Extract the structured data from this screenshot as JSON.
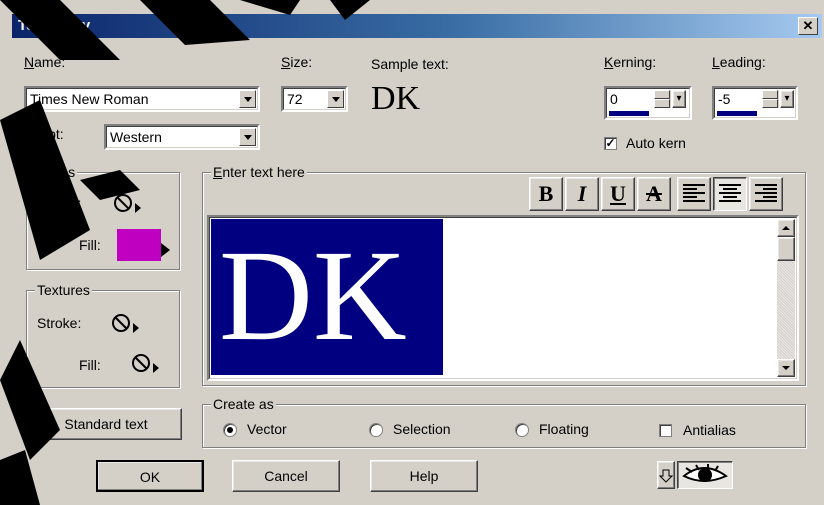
{
  "window": {
    "title": "Text Entry",
    "close_glyph": "✕"
  },
  "name": {
    "label": "Name:",
    "value": "Times New Roman"
  },
  "size": {
    "label": "Size:",
    "value": "72"
  },
  "sample": {
    "label": "Sample text:",
    "value": "DK"
  },
  "kerning": {
    "label": "Kerning:",
    "value": "0"
  },
  "leading": {
    "label": "Leading:",
    "value": "-5"
  },
  "auto_kern": {
    "label": "Auto kern",
    "checked": true,
    "check_glyph": "✓"
  },
  "script": {
    "label": "Script:",
    "value": "Western"
  },
  "styles": {
    "title": "Styles",
    "stroke_label": "Stroke:",
    "fill_label": "Fill:",
    "fill_color": "#c000c0"
  },
  "textures": {
    "title": "Textures",
    "stroke_label": "Stroke:",
    "fill_label": "Fill:"
  },
  "editor": {
    "title": "Enter text here",
    "content": "DK",
    "highlight_color": "#000080"
  },
  "format": {
    "bold": "B",
    "italic": "I",
    "underline": "U",
    "strike": "A"
  },
  "create_as": {
    "title": "Create as",
    "options": [
      "Vector",
      "Selection",
      "Floating"
    ],
    "selected": "Vector",
    "antialias_label": "Antialias"
  },
  "buttons": {
    "standard_text": "Standard text",
    "ok": "OK",
    "cancel": "Cancel",
    "help": "Help"
  },
  "icons": {
    "no_sign": "no-symbol-icon",
    "preview": "eye-icon",
    "arrow": "down-arrow-icon"
  }
}
